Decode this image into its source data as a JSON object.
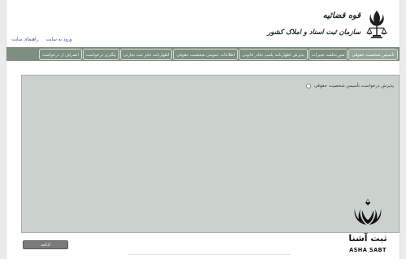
{
  "header": {
    "org_line1": "قوه قضائیه",
    "org_line2": "سازمان ثبت اسناد و املاک کشور",
    "links": [
      "ورود به سایت",
      "راهنمای سایت"
    ]
  },
  "nav": {
    "tabs": [
      "تأسیس شخصیت حقوقی",
      "صورتجلسه تغییرات",
      "پذیرش اظهارنامه پلمپ دفاتر قانونی",
      "اطلاعات عمومی شخصیت حقوقی",
      "اظهارنامه دفتر ثبت تجارتی",
      "پیگیری درخواست",
      "انصراف از درخواست"
    ],
    "active_index": 0
  },
  "content": {
    "option_label": "پذیرش درخواست تأسیس شخصیت حقوقی"
  },
  "actions": {
    "continue_label": "ادامه"
  },
  "watermark": {
    "text_fa": "ثبت آشنا",
    "text_en": "ASHA SABT"
  },
  "colors": {
    "nav_bg": "#7d8f7f",
    "content_bg": "#cbd1cc",
    "button_bg": "#7a7a7a"
  }
}
